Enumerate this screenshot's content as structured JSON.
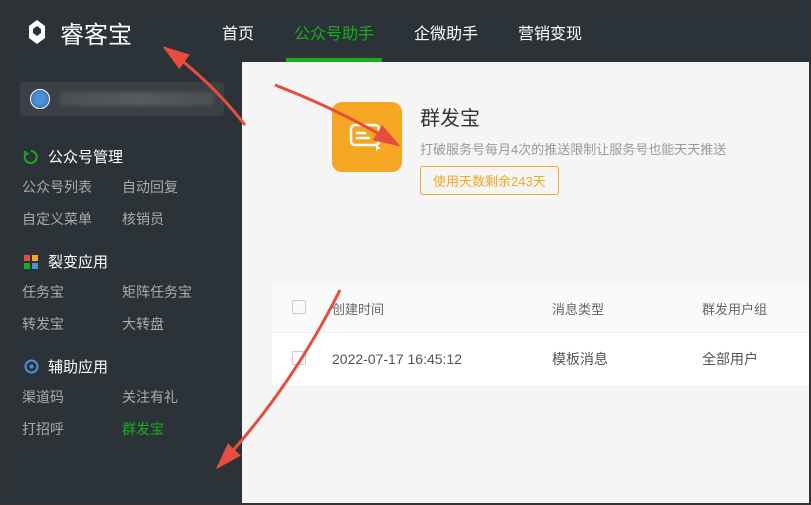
{
  "header": {
    "logo_text": "睿客宝",
    "nav": [
      {
        "label": "首页",
        "active": false
      },
      {
        "label": "公众号助手",
        "active": true
      },
      {
        "label": "企微助手",
        "active": false
      },
      {
        "label": "营销变现",
        "active": false
      }
    ]
  },
  "sidebar": {
    "sections": [
      {
        "title": "公众号管理",
        "icon": "refresh-icon",
        "icon_color": "#1aad19",
        "items": [
          "公众号列表",
          "自动回复",
          "自定义菜单",
          "核销员"
        ]
      },
      {
        "title": "裂变应用",
        "icon": "grid-icon",
        "icon_color": "#f5a623",
        "items": [
          "任务宝",
          "矩阵任务宝",
          "转发宝",
          "大转盘"
        ]
      },
      {
        "title": "辅助应用",
        "icon": "puzzle-icon",
        "icon_color": "#4a90d9",
        "items": [
          "渠道码",
          "关注有礼",
          "打招呼",
          "群发宝"
        ],
        "active_item": "群发宝"
      }
    ]
  },
  "main": {
    "feature": {
      "title": "群发宝",
      "desc": "打破服务号每月4次的推送限制让服务号也能天天推送",
      "badge": "使用天数剩余243天"
    },
    "table": {
      "headers": [
        "创建时间",
        "消息类型",
        "群发用户组"
      ],
      "rows": [
        {
          "time": "2022-07-17 16:45:12",
          "type": "模板消息",
          "group": "全部用户"
        }
      ]
    }
  }
}
